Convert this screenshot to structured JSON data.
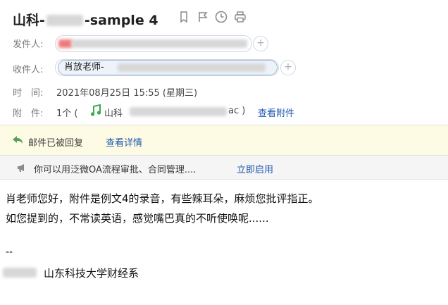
{
  "email": {
    "subject_prefix": "山科-",
    "subject_suffix": "-sample 4",
    "sender": {
      "label": "发件人:"
    },
    "recipient": {
      "label": "收件人:",
      "chip_text": "肖放老师-"
    },
    "time": {
      "label": "时　间:",
      "value": "2021年08月25日 15:55 (星期三)"
    },
    "attachment": {
      "label": "附　件:",
      "count_open": "1个 (",
      "file_prefix": "山科",
      "file_suffix": "ac )",
      "view_link": "查看附件"
    },
    "add_symbol": "+"
  },
  "reply_notice": {
    "text": "邮件已被回复",
    "link": "查看详情"
  },
  "promo": {
    "text": "你可以用泛微OA流程审批、合同管理....",
    "link": "立即启用"
  },
  "message": {
    "line1": "肖老师您好，附件是例文4的录音，有些辣耳朵，麻烦您批评指正。",
    "line2": "如您提到的，不常读英语，感觉嘴巴真的不听使唤呢......",
    "separator": "--",
    "signature": "山东科技大学财经系"
  },
  "colors": {
    "reply_band": "#fdfbe3",
    "promo_band": "#f5f5f5",
    "link": "#1a56b0",
    "reply_arrow": "#5aa05a",
    "music_note": "#3aaa4a",
    "sender_redact": "#f07a7a"
  },
  "icons": [
    "star-icon",
    "flag-icon",
    "clock-icon",
    "print-icon",
    "reply-arrow-icon",
    "music-note-icon",
    "megaphone-icon"
  ]
}
